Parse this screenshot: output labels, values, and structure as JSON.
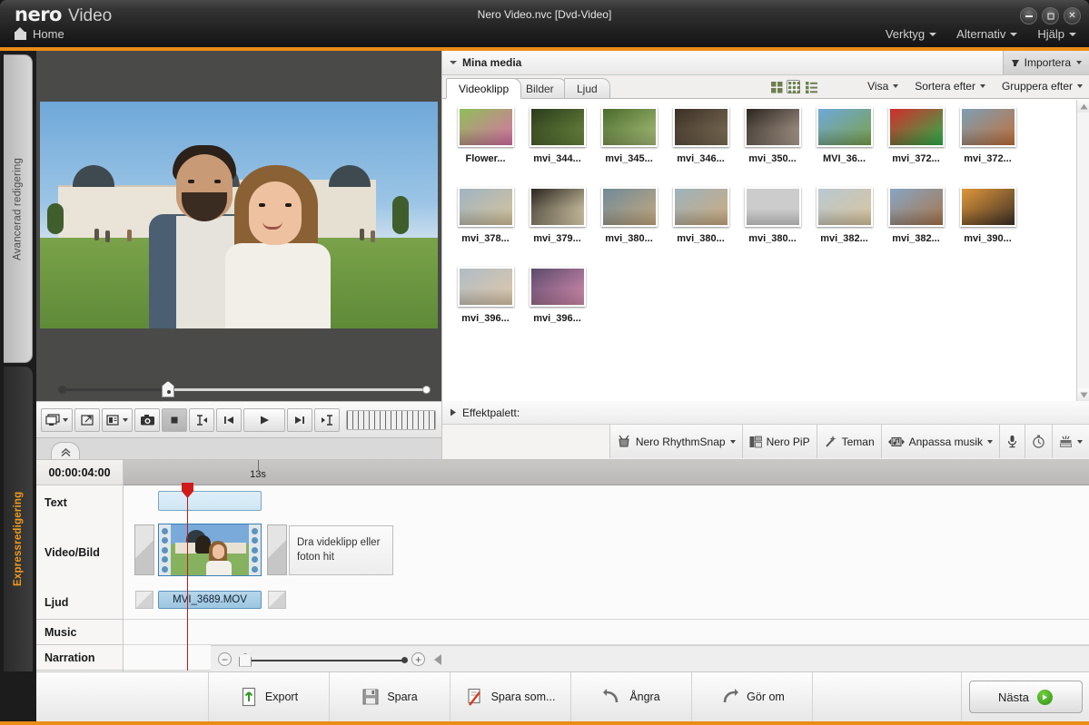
{
  "window": {
    "brand_nero": "nero",
    "brand_app": "Video",
    "title": "Nero Video.nvc [Dvd-Video]",
    "home_label": "Home",
    "minimize_icon": "minimize-icon",
    "maximize_icon": "maximize-icon",
    "close_icon": "close-icon",
    "close_glyph": "✕",
    "menus": [
      {
        "label": "Verktyg"
      },
      {
        "label": "Alternativ"
      },
      {
        "label": "Hjälp"
      }
    ]
  },
  "mode_tabs": [
    {
      "label": "Avancerad redigering",
      "active": false
    },
    {
      "label": "Expressredigering",
      "active": true
    }
  ],
  "preview": {
    "transport": [
      {
        "name": "display-mode-button",
        "icon": "monitor-icon",
        "dropdown": true
      },
      {
        "name": "fullscreen-button",
        "icon": "expand-icon",
        "dropdown": false
      },
      {
        "name": "layout-button",
        "icon": "layout-icon",
        "dropdown": true
      },
      {
        "name": "snapshot-button",
        "icon": "camera-icon",
        "dropdown": false
      },
      {
        "name": "stop-button",
        "icon": "stop-icon",
        "dropdown": false,
        "active": true
      },
      {
        "name": "mark-in-button",
        "icon": "mark-in-icon",
        "dropdown": false
      },
      {
        "name": "step-back-button",
        "icon": "step-back-icon",
        "dropdown": false
      },
      {
        "name": "play-button",
        "icon": "play-icon",
        "dropdown": false
      },
      {
        "name": "step-forward-button",
        "icon": "step-forward-icon",
        "dropdown": false
      },
      {
        "name": "mark-out-button",
        "icon": "mark-out-icon",
        "dropdown": false
      }
    ]
  },
  "media_panel": {
    "title": "Mina media",
    "import_label": "Importera",
    "tabs": [
      {
        "label": "Videoklipp",
        "selected": true
      },
      {
        "label": "Bilder",
        "selected": false
      },
      {
        "label": "Ljud",
        "selected": false
      }
    ],
    "view_modes": [
      {
        "name": "view-mode-large-icons",
        "selected": false
      },
      {
        "name": "view-mode-grid",
        "selected": true
      },
      {
        "name": "view-mode-details",
        "selected": false
      }
    ],
    "dropdowns": [
      {
        "label": "Visa"
      },
      {
        "label": "Sortera efter"
      },
      {
        "label": "Gruppera efter"
      }
    ],
    "items": [
      {
        "caption": "Flower...",
        "c1": "#8fbf58",
        "c2": "#d96fa8"
      },
      {
        "caption": "mvi_344...",
        "c1": "#2b3a1c",
        "c2": "#6c8a3f"
      },
      {
        "caption": "mvi_345...",
        "c1": "#4b6b2c",
        "c2": "#a9c07a"
      },
      {
        "caption": "mvi_346...",
        "c1": "#3b3026",
        "c2": "#7f7058"
      },
      {
        "caption": "mvi_350...",
        "c1": "#2a2520",
        "c2": "#b3a193"
      },
      {
        "caption": "MVI_36...",
        "c1": "#6fa8d8",
        "c2": "#7aa24a"
      },
      {
        "caption": "mvi_372...",
        "c1": "#d42b2b",
        "c2": "#2bb34a"
      },
      {
        "caption": "mvi_372...",
        "c1": "#7d9fb5",
        "c2": "#c0703a"
      },
      {
        "caption": "mvi_378...",
        "c1": "#9fb4c2",
        "c2": "#d7c39a"
      },
      {
        "caption": "mvi_379...",
        "c1": "#2a2620",
        "c2": "#e8dcb8"
      },
      {
        "caption": "mvi_380...",
        "c1": "#6f8a99",
        "c2": "#c7a97e"
      },
      {
        "caption": "mvi_380...",
        "c1": "#9db3bd",
        "c2": "#cdaa7d"
      },
      {
        "caption": "mvi_380...",
        "c1": "#a8bcc6",
        "c2": "#d2b храм88"
      },
      {
        "caption": "mvi_382...",
        "c1": "#b9c9d2",
        "c2": "#d9c49c"
      },
      {
        "caption": "mvi_382...",
        "c1": "#87a6c4",
        "c2": "#a8744a"
      },
      {
        "caption": "mvi_390...",
        "c1": "#e0973a",
        "c2": "#3c3026"
      },
      {
        "caption": "mvi_396...",
        "c1": "#b0bcc6",
        "c2": "#e0c8a8"
      },
      {
        "caption": "mvi_396...",
        "c1": "#5b4a6b",
        "c2": "#d88fb0"
      }
    ]
  },
  "effects_panel": {
    "title": "Effektpalett:",
    "tools": [
      {
        "label": "Nero RhythmSnap",
        "icon": "drum-icon",
        "dropdown": true
      },
      {
        "label": "Nero PiP",
        "icon": "pip-icon",
        "dropdown": false
      },
      {
        "label": "Teman",
        "icon": "wand-icon",
        "dropdown": false
      },
      {
        "label": "Anpassa musik",
        "icon": "music-fit-icon",
        "dropdown": true
      },
      {
        "label": "",
        "icon": "microphone-icon",
        "dropdown": false
      },
      {
        "label": "",
        "icon": "stopwatch-icon",
        "dropdown": false
      },
      {
        "label": "",
        "icon": "burn-icon",
        "dropdown": true
      }
    ]
  },
  "timeline": {
    "timecode": "00:00:04:00",
    "ruler_label": "13s",
    "tracks": [
      {
        "label": "Text"
      },
      {
        "label": "Video/Bild"
      },
      {
        "label": "Ljud"
      },
      {
        "label": "Music"
      },
      {
        "label": "Narration"
      }
    ],
    "drop_hint": "Dra videklipp eller foton hit",
    "audio_clip_label": "MVI_3689.MOV",
    "zoom_out_glyph": "−",
    "zoom_in_glyph": "+"
  },
  "actions": [
    {
      "label": "Export",
      "icon": "export-icon"
    },
    {
      "label": "Spara",
      "icon": "save-icon"
    },
    {
      "label": "Spara som...",
      "icon": "save-as-icon"
    },
    {
      "label": "Ångra",
      "icon": "undo-icon"
    },
    {
      "label": "Gör om",
      "icon": "redo-icon"
    }
  ],
  "next_button": {
    "label": "Nästa",
    "icon": "arrow-right-icon"
  },
  "colors": {
    "accent_orange": "#eb8c16",
    "playhead_red": "#c01717",
    "next_green": "#3d9a16"
  }
}
